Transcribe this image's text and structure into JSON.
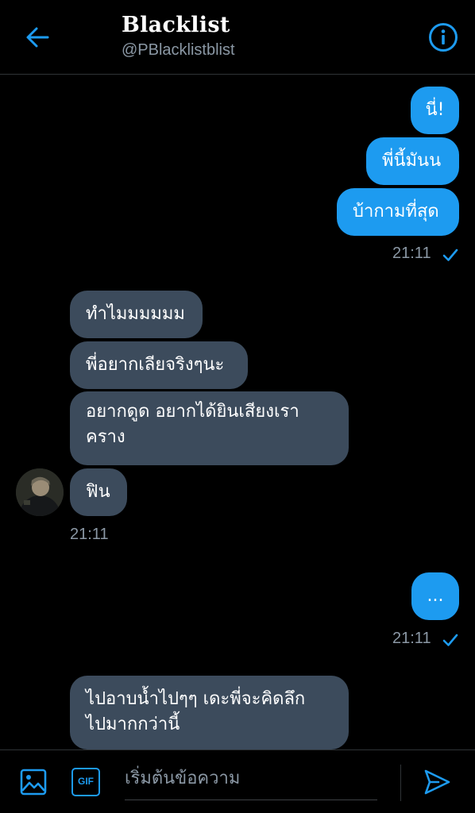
{
  "header": {
    "title": "Blacklist",
    "handle": "@PBlacklistblist"
  },
  "messages": {
    "out1": "นี่!",
    "out2": "พี่นี้มันน",
    "out3": "บ้ากามที่สุด",
    "time1": "21:11",
    "in1": "ทำไมมมมมม",
    "in2": "พี่อยากเลียจริงๆนะ",
    "in3_line1": "อยากดูด อยากได้ยินเสียงเรา",
    "in3_line2": "คราง",
    "in4": "ฟิน",
    "time2": "21:11",
    "out4": "...",
    "time3": "21:11",
    "in5_line1": "ไปอาบน้ำไปๆๆ เดะพี่จะคิดลึก",
    "in5_line2": "ไปมากกว่านี้"
  },
  "composer": {
    "placeholder": "เริ่มต้นข้อความ",
    "gif_label": "GIF"
  },
  "colors": {
    "accent": "#1d9bf0",
    "incoming_bubble": "#3c4b5c",
    "muted_text": "#8b98a5",
    "background": "#000000"
  }
}
